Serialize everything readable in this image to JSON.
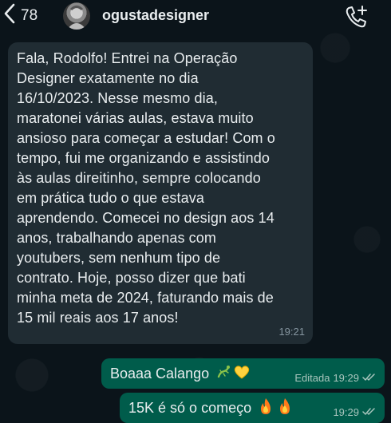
{
  "header": {
    "back_count": "78",
    "contact_name": "ogustadesigner"
  },
  "messages": [
    {
      "direction": "incoming",
      "text": "Fala, Rodolfo! Entrei na Operação\nDesigner exatamente no dia\n16/10/2023. Nesse mesmo dia,\nmaratonei várias aulas, estava muito\nansioso para começar a estudar! Com o\ntempo, fui me organizando e assistindo\nàs aulas direitinho, sempre colocando\nem prática tudo o que estava\naprendendo. Comecei no design aos 14\nanos, trabalhando apenas com\nyoutubers, sem nenhum tipo de\ncontrato. Hoje, posso dizer que bati\nminha meta de 2024, faturando mais de\n15 mil reais aos 17 anos!",
      "time": "19:21"
    },
    {
      "direction": "outgoing",
      "text": "Boaaa Calango",
      "emoji": [
        "lizard",
        "yellow-heart"
      ],
      "edited_label": "Editada",
      "time": "19:29",
      "status": "read"
    },
    {
      "direction": "outgoing",
      "text": "15K é só o começo",
      "emoji": [
        "fire",
        "fire"
      ],
      "time": "19:29",
      "status": "read"
    }
  ],
  "colors": {
    "background": "#0b141a",
    "incoming_bubble": "#202c33",
    "outgoing_bubble": "#005c4b",
    "text": "#e9edef",
    "meta": "#8696a0"
  }
}
